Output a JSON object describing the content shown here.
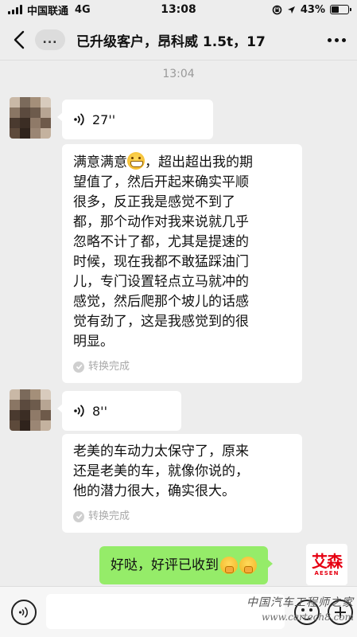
{
  "status_bar": {
    "carrier": "中国联通",
    "network": "4G",
    "time": "13:08",
    "battery": "43%",
    "battery_level": 0.43
  },
  "header": {
    "unread_label": "...",
    "title": "已升级客户，昂科威 1.5t，17"
  },
  "messages": {
    "timestamp": "13:04",
    "voice1": {
      "duration": "27''",
      "transcript": "满意满意",
      "transcript_rest": "，超出超出我的期\n望值了，然后开起来确实平顺\n很多，反正我是感觉不到了\n都，那个动作对我来说就几乎\n忽略不计了都，尤其是提速的\n时候，现在我都不敢猛踩油门\n儿，专门设置轻点立马就冲的\n感觉，然后爬那个坡儿的话感\n觉有劲了，这是我感觉到的很\n明显。",
      "status": "转换完成"
    },
    "voice2": {
      "duration": "8''",
      "transcript": "老美的车动力太保守了，原来\n还是老美的车，就像你说的，\n他的潜力很大，确实很大。",
      "status": "转换完成"
    },
    "reply": {
      "text": "好哒，好评已收到"
    }
  },
  "self_avatar": {
    "brand": "艾森",
    "sub": "AESEN"
  },
  "watermark": {
    "cn": "中国汽车工程师之家",
    "url": "www.cartech8.com"
  },
  "colors": {
    "background": "#ededed",
    "bubble_in": "#ffffff",
    "bubble_out": "#95ec69",
    "brand_red": "#e60012"
  }
}
